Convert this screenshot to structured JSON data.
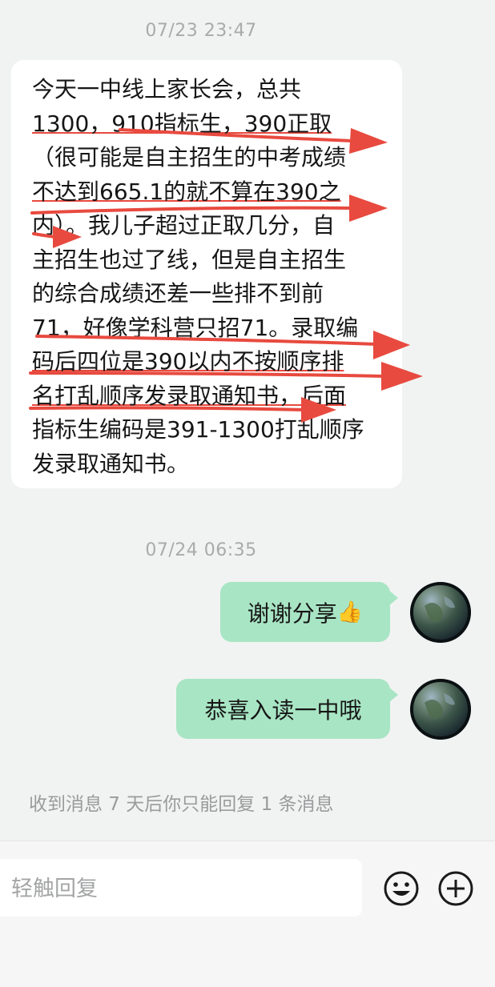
{
  "chat": {
    "messages": [
      {
        "timestamp": "07/23 23:47",
        "direction": "incoming",
        "lines": [
          "今天一中线上家长会，总共",
          "1300，910指标生，390正取",
          "（很可能是自主招生的中考成绩",
          "不达到665.1的就不算在390之",
          "内）。我儿子超过正取几分，自",
          "主招生也过了线，但是自主招生",
          "的综合成绩还差一些排不到前",
          "71，好像学科营只招71。录取编",
          "码后四位是390以内不按顺序排",
          "名打乱顺序发录取通知书，后面",
          "指标生编码是391-1300打乱顺序",
          "发录取通知书。"
        ]
      },
      {
        "timestamp": "07/24 06:35",
        "direction": "outgoing",
        "text": "谢谢分享",
        "emoji": "👍"
      },
      {
        "direction": "outgoing",
        "text": "恭喜入读一中哦"
      }
    ],
    "reply_limit_notice": "收到消息 7 天后你只能回复 1 条消息"
  },
  "input": {
    "placeholder": "轻触回复"
  },
  "icons": {
    "emoji_button": "smiley-icon",
    "plus_button": "plus-circle-icon"
  },
  "colors": {
    "background": "#f1f3f2",
    "incoming_bubble": "#ffffff",
    "outgoing_bubble": "#a8e5c4",
    "annotation_red": "#e84a3f"
  }
}
